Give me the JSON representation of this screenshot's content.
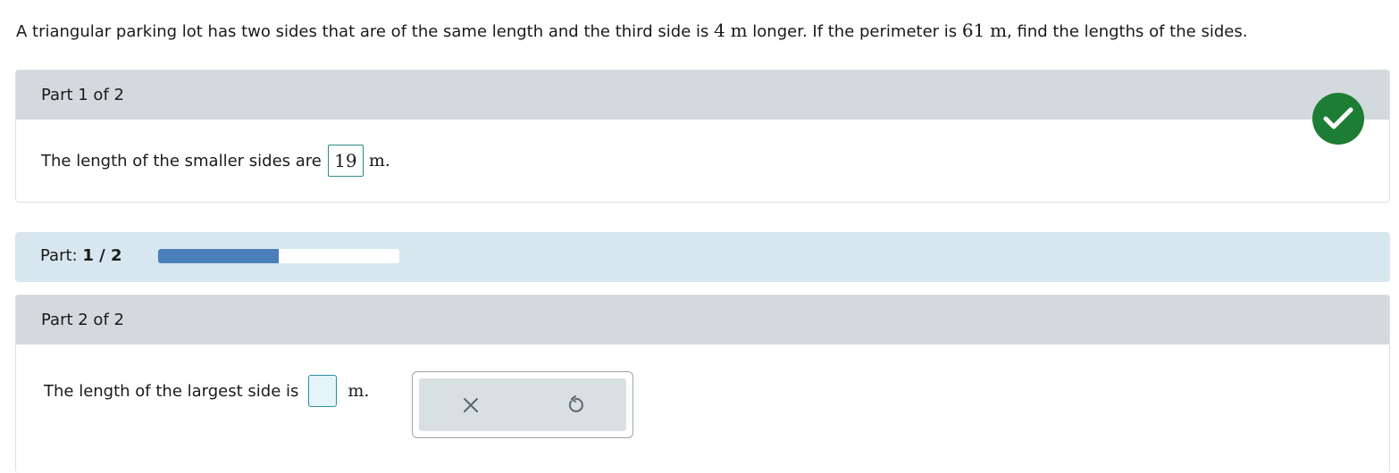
{
  "problem": {
    "text_a": "A triangular parking lot has two sides that are of the same length and the third side is ",
    "num_a": "4",
    "unit_a": "m",
    "text_b": " longer. If the perimeter is ",
    "num_b": "61",
    "unit_b": "m",
    "text_c": ", find the lengths of the sides."
  },
  "part1": {
    "header": "Part 1 of 2",
    "prompt": "The length of the smaller sides are",
    "answer": "19",
    "unit": "m."
  },
  "status": {
    "correct_icon": "checkmark-icon",
    "color": "#1e7d35"
  },
  "progress": {
    "label": "Part:",
    "value": "1 / 2",
    "fraction": 0.5,
    "fill_color": "#4a7fba"
  },
  "part2": {
    "header": "Part 2 of 2",
    "prompt": "The length of the largest side is",
    "answer": "",
    "unit": "m."
  },
  "tools": {
    "clear_icon": "close-icon",
    "undo_icon": "undo-icon"
  }
}
